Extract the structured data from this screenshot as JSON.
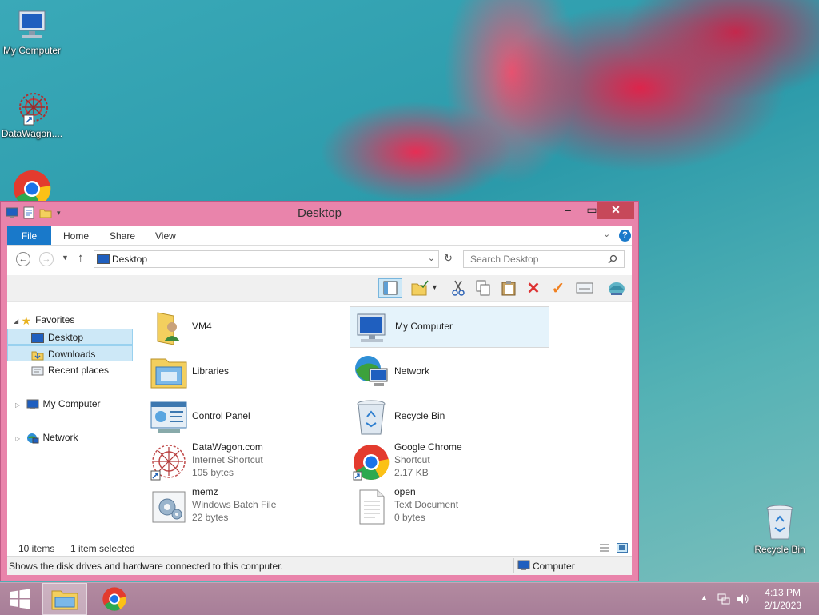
{
  "desktop": {
    "icons": [
      {
        "label": "My Computer"
      },
      {
        "label": "DataWagon...."
      },
      {
        "label": "Recycle Bin"
      }
    ]
  },
  "window": {
    "title": "Desktop",
    "ribbon_tabs": [
      "File",
      "Home",
      "Share",
      "View"
    ],
    "address": "Desktop",
    "search_placeholder": "Search Desktop",
    "nav": {
      "favorites": "Favorites",
      "desktop": "Desktop",
      "downloads": "Downloads",
      "recent": "Recent places",
      "my_computer": "My Computer",
      "network": "Network"
    },
    "items": [
      {
        "name": "VM4",
        "line2": "",
        "line3": "",
        "icon": "user-folder-icon"
      },
      {
        "name": "My Computer",
        "line2": "",
        "line3": "",
        "icon": "computer-icon"
      },
      {
        "name": "Libraries",
        "line2": "",
        "line3": "",
        "icon": "libraries-icon"
      },
      {
        "name": "Network",
        "line2": "",
        "line3": "",
        "icon": "network-icon"
      },
      {
        "name": "Control Panel",
        "line2": "",
        "line3": "",
        "icon": "control-panel-icon"
      },
      {
        "name": "Recycle Bin",
        "line2": "",
        "line3": "",
        "icon": "recycle-bin-icon"
      },
      {
        "name": "DataWagon.com",
        "line2": "Internet Shortcut",
        "line3": "105 bytes",
        "icon": "datawagon-icon"
      },
      {
        "name": "Google Chrome",
        "line2": "Shortcut",
        "line3": "2.17 KB",
        "icon": "chrome-icon"
      },
      {
        "name": "memz",
        "line2": "Windows Batch File",
        "line3": "22 bytes",
        "icon": "batch-file-icon"
      },
      {
        "name": "open",
        "line2": "Text Document",
        "line3": "0 bytes",
        "icon": "text-document-icon"
      }
    ],
    "status": {
      "count": "10 items",
      "selection": "1 item selected"
    },
    "info": {
      "text": "Shows the disk drives and hardware connected to this computer.",
      "location": "Computer"
    }
  },
  "taskbar": {
    "time": "4:13 PM",
    "date": "2/1/2023"
  },
  "colors": {
    "accent": "#1979ca",
    "window_frame": "#e984ab",
    "close_button": "#c7485a"
  }
}
